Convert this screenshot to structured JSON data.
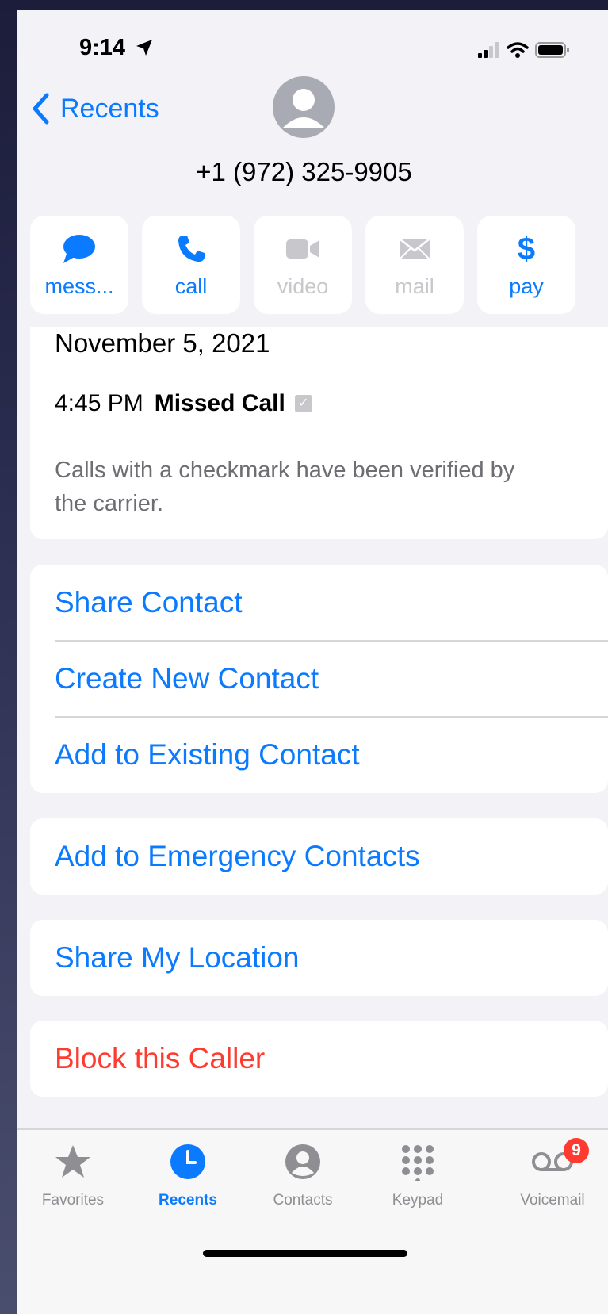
{
  "status_bar": {
    "time": "9:14"
  },
  "nav": {
    "back_label": "Recents"
  },
  "contact": {
    "phone_number": "+1 (972) 325-9905"
  },
  "actions": [
    {
      "label": "mess...",
      "icon": "message-bubble-icon",
      "enabled": true
    },
    {
      "label": "call",
      "icon": "phone-icon",
      "enabled": true
    },
    {
      "label": "video",
      "icon": "video-camera-icon",
      "enabled": false
    },
    {
      "label": "mail",
      "icon": "envelope-icon",
      "enabled": false
    },
    {
      "label": "pay",
      "icon": "dollar-icon",
      "enabled": true
    }
  ],
  "history": {
    "date": "November 5, 2021",
    "time": "4:45 PM",
    "type": "Missed Call",
    "note": "Calls with a checkmark have been verified by the carrier."
  },
  "menu_group_1": [
    {
      "label": "Share Contact"
    },
    {
      "label": "Create New Contact"
    },
    {
      "label": "Add to Existing Contact"
    }
  ],
  "menu_emergency": {
    "label": "Add to Emergency Contacts"
  },
  "menu_location": {
    "label": "Share My Location"
  },
  "menu_block": {
    "label": "Block this Caller"
  },
  "tabs": [
    {
      "label": "Favorites",
      "icon": "star-icon"
    },
    {
      "label": "Recents",
      "icon": "clock-icon",
      "active": true
    },
    {
      "label": "Contacts",
      "icon": "person-circle-icon"
    },
    {
      "label": "Keypad",
      "icon": "keypad-icon"
    },
    {
      "label": "Voicemail",
      "icon": "voicemail-icon",
      "badge": "9"
    }
  ],
  "colors": {
    "accent": "#0a7aff",
    "destructive": "#ff3b30",
    "background": "#f2f2f7"
  }
}
